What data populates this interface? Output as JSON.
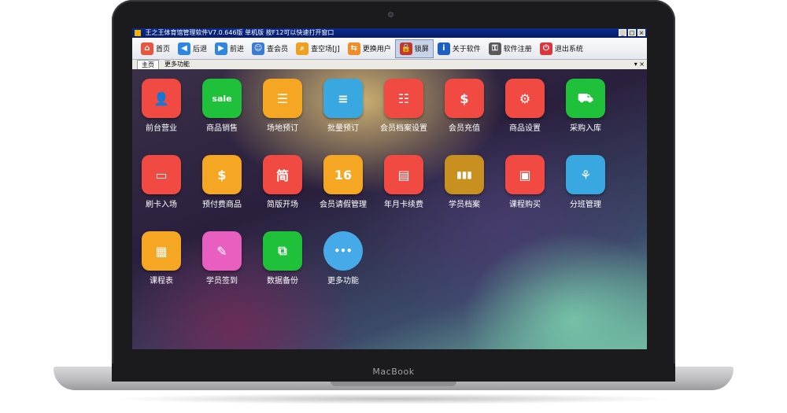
{
  "window": {
    "title": "王之王体育馆管理软件V7.0.646版 单机版 按F12可以快速打开窗口",
    "controls": [
      "_",
      "□",
      "×"
    ]
  },
  "toolbar": {
    "items": [
      {
        "label": "首页",
        "icon": "home-icon",
        "color": "#e9553f"
      },
      {
        "label": "后退",
        "icon": "arrow-left-icon",
        "color": "#2e86de"
      },
      {
        "label": "前进",
        "icon": "arrow-right-icon",
        "color": "#2e86de"
      },
      {
        "label": "查会员",
        "icon": "member-icon",
        "color": "#3a7bd5"
      },
      {
        "label": "查空场[J]",
        "icon": "magnifier-icon",
        "color": "#f0a020"
      },
      {
        "label": "更换用户",
        "icon": "switch-user-icon",
        "color": "#f28c28"
      },
      {
        "label": "锁屏",
        "icon": "lock-icon",
        "color": "#c0392b",
        "active": true
      },
      {
        "label": "关于软件",
        "icon": "info-icon",
        "color": "#1e5fc2"
      },
      {
        "label": "软件注册",
        "icon": "key-icon",
        "color": "#5a5a5a"
      },
      {
        "label": "退出系统",
        "icon": "power-icon",
        "color": "#d9363e"
      }
    ]
  },
  "tabs": {
    "main": "主页",
    "more": "更多功能",
    "controls": "▾ ×"
  },
  "tiles": [
    {
      "label": "前台营业",
      "icon": "receptionist-icon",
      "color": "#f04a42",
      "glyph": "👤"
    },
    {
      "label": "商品销售",
      "icon": "sale-bag-icon",
      "color": "#1fc13a",
      "glyph": "sale"
    },
    {
      "label": "场地预订",
      "icon": "checklist-icon",
      "color": "#f5a623",
      "glyph": "☰"
    },
    {
      "label": "批量预订",
      "icon": "stack-icon",
      "color": "#3aa8e0",
      "glyph": "≡"
    },
    {
      "label": "会员档案设置",
      "icon": "member-file-icon",
      "color": "#f04a42",
      "glyph": "☷"
    },
    {
      "label": "会员充值",
      "icon": "money-bag-icon",
      "color": "#f04a42",
      "glyph": "$"
    },
    {
      "label": "商品设置",
      "icon": "bag-settings-icon",
      "color": "#f04a42",
      "glyph": "⚙"
    },
    {
      "label": "采购入库",
      "icon": "hand-truck-icon",
      "color": "#1fc13a",
      "glyph": "⛟"
    },
    {
      "label": "刷卡入场",
      "icon": "card-swipe-icon",
      "color": "#f04a42",
      "glyph": "▭"
    },
    {
      "label": "预付费商品",
      "icon": "gift-icon",
      "color": "#f5a623",
      "glyph": "$"
    },
    {
      "label": "简版开场",
      "icon": "receptionist-simple-icon",
      "color": "#f04a42",
      "glyph": "简"
    },
    {
      "label": "会员请假管理",
      "icon": "calendar-icon",
      "color": "#f5a623",
      "glyph": "16"
    },
    {
      "label": "年月卡续费",
      "icon": "wallet-icon",
      "color": "#f04a42",
      "glyph": "▤"
    },
    {
      "label": "学员档案",
      "icon": "binders-icon",
      "color": "#c8911f",
      "glyph": "▮▮▮"
    },
    {
      "label": "课程购买",
      "icon": "briefcase-icon",
      "color": "#f04a42",
      "glyph": "▣"
    },
    {
      "label": "分班管理",
      "icon": "org-chart-icon",
      "color": "#3aa8e0",
      "glyph": "⚘"
    },
    {
      "label": "课程表",
      "icon": "schedule-icon",
      "color": "#f5a623",
      "glyph": "▦"
    },
    {
      "label": "学员签到",
      "icon": "sign-in-icon",
      "color": "#e85fc0",
      "glyph": "✎"
    },
    {
      "label": "数据备份",
      "icon": "backup-icon",
      "color": "#1fc13a",
      "glyph": "⧉"
    },
    {
      "label": "更多功能",
      "icon": "chat-bubble-icon",
      "color": "#46a9e8",
      "glyph": "•••"
    }
  ],
  "device": {
    "brand": "MacBook"
  }
}
